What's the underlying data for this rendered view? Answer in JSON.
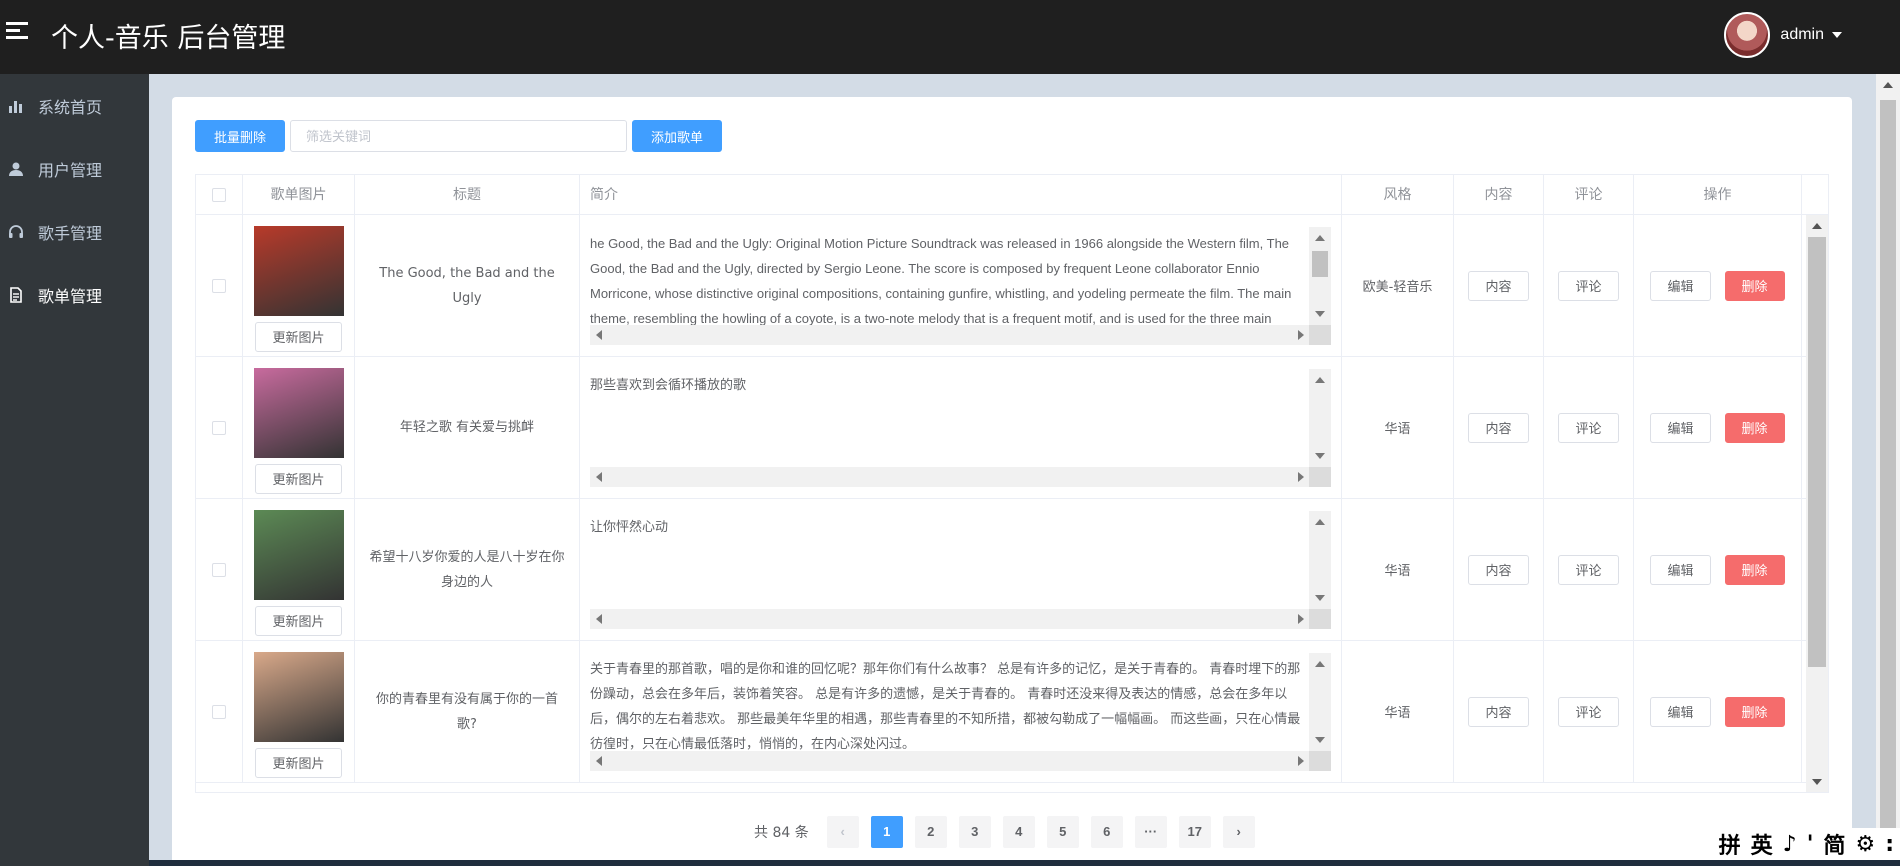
{
  "header": {
    "title": "个人-音乐 后台管理",
    "username": "admin"
  },
  "sidebar": {
    "items": [
      {
        "label": "系统首页",
        "icon": "bar-chart-icon"
      },
      {
        "label": "用户管理",
        "icon": "user-icon"
      },
      {
        "label": "歌手管理",
        "icon": "headset-icon"
      },
      {
        "label": "歌单管理",
        "icon": "document-icon",
        "active": true
      }
    ]
  },
  "toolbar": {
    "batch_delete": "批量删除",
    "search_placeholder": "筛选关键词",
    "add_playlist": "添加歌单"
  },
  "table": {
    "columns": [
      "歌单图片",
      "标题",
      "简介",
      "风格",
      "内容",
      "评论",
      "操作"
    ],
    "row_buttons": {
      "update_image": "更新图片",
      "content": "内容",
      "comment": "评论",
      "edit": "编辑",
      "delete": "删除"
    },
    "rows": [
      {
        "title": "The Good, the Bad and the Ugly",
        "intro": "he Good, the Bad and the Ugly: Original Motion Picture Soundtrack was released in 1966 alongside the Western film, The Good, the Bad and the Ugly, directed by Sergio Leone. The score is composed by frequent Leone collaborator Ennio Morricone, whose distinctive original compositions, containing gunfire, whistling, and yodeling permeate the film. The main theme, resembling the howling of a coyote, is a two-note melody that is a frequent motif, and is used for the three main characters.",
        "style": "欧美-轻音乐",
        "cover_color": "#b83a2a"
      },
      {
        "title": "年轻之歌 有关爱与挑衅",
        "intro": "那些喜欢到会循环播放的歌",
        "style": "华语",
        "cover_color": "#c86b9e"
      },
      {
        "title": "希望十八岁你爱的人是八十岁在你身边的人",
        "intro": "让你怦然心动",
        "style": "华语",
        "cover_color": "#5c8a55"
      },
      {
        "title": "你的青春里有没有属于你的一首歌?",
        "intro": "关于青春里的那首歌，唱的是你和谁的回忆呢？那年你们有什么故事？ 总是有许多的记忆，是关于青春的。 青春时埋下的那份躁动，总会在多年后，装饰着笑容。 总是有许多的遗憾，是关于青春的。 青春时还没来得及表达的情感，总会在多年以后，偶尔的左右着悲欢。 那些最美年华里的相遇，那些青春里的不知所措，都被勾勒成了一幅幅画。 而这些画，只在心情最彷徨时，只在心情最低落时，悄悄的，在内心深处闪过。",
        "style": "华语",
        "cover_color": "#d9a98a"
      }
    ]
  },
  "pagination": {
    "total": "共 84 条",
    "pages": [
      "1",
      "2",
      "3",
      "4",
      "5",
      "6",
      "···",
      "17"
    ],
    "current": "1"
  },
  "ime": {
    "items": [
      "拼",
      "英",
      "♪",
      "'",
      "简",
      "⚙",
      ":"
    ]
  }
}
